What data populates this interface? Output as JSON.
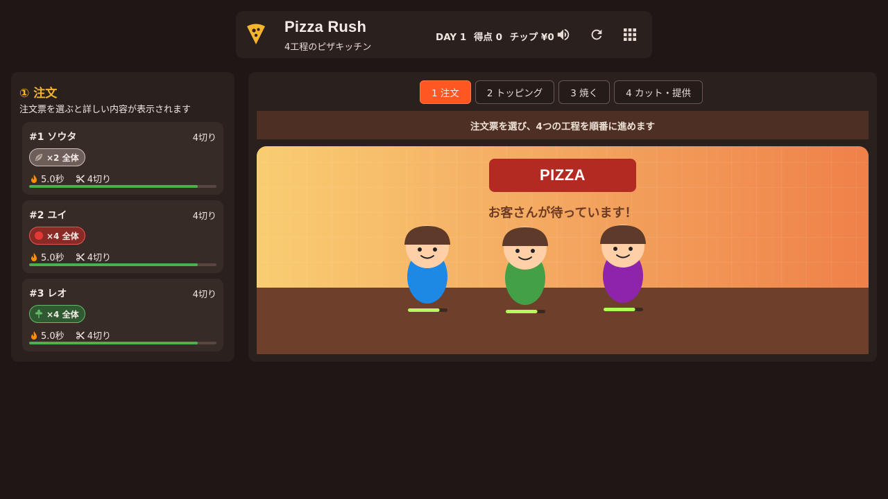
{
  "header": {
    "title": "Pizza Rush",
    "subtitle": "4工程のピザキッチン",
    "day": "DAY 1",
    "score": "得点 0",
    "tips": "チップ ¥0",
    "icons": [
      "pizza-logo-icon",
      "volume-icon",
      "restart-icon",
      "grid-menu-icon"
    ]
  },
  "orders_panel": {
    "title": "① 注文",
    "subtitle": "注文票を選ぶと詳しい内容が表示されます",
    "orders": [
      {
        "name": "#1 ソウタ",
        "cut": "4切り",
        "topping": "×2 全体",
        "topping_icon": "leaf-icon",
        "chip_bg": "#6d5e59",
        "chip_border": "#cfc2bb",
        "time": "5.0秒",
        "slices": "4切り",
        "progress": 0.9
      },
      {
        "name": "#2 ユイ",
        "cut": "4切り",
        "topping": "×4 全体",
        "topping_icon": "pepperoni-icon",
        "chip_bg": "#8a2a26",
        "chip_border": "#e45a52",
        "time": "5.0秒",
        "slices": "4切り",
        "progress": 0.9
      },
      {
        "name": "#3 レオ",
        "cut": "4切り",
        "topping": "×4 全体",
        "topping_icon": "basil-icon",
        "chip_bg": "#2f5a31",
        "chip_border": "#66bb6a",
        "time": "5.0秒",
        "slices": "4切り",
        "progress": 0.9
      }
    ]
  },
  "tabs": [
    {
      "label": "1 注文",
      "active": true
    },
    {
      "label": "2 トッピング",
      "active": false
    },
    {
      "label": "3 焼く",
      "active": false
    },
    {
      "label": "4 カット・提供",
      "active": false
    }
  ],
  "banner": "注文票を選び、4つの工程を順番に進めます",
  "scene": {
    "sign": "PIZZA",
    "message": "お客さんが待っています！",
    "customers": [
      {
        "body_color": "#1e88e5",
        "patience": 0.8
      },
      {
        "body_color": "#43a047",
        "patience": 0.8
      },
      {
        "body_color": "#8e24aa",
        "patience": 0.8
      }
    ]
  },
  "colors": {
    "accent": "#ff5722",
    "title_yellow": "#f5b52c",
    "progress_green": "#4caf50",
    "patience_lime": "#b2ff59"
  }
}
